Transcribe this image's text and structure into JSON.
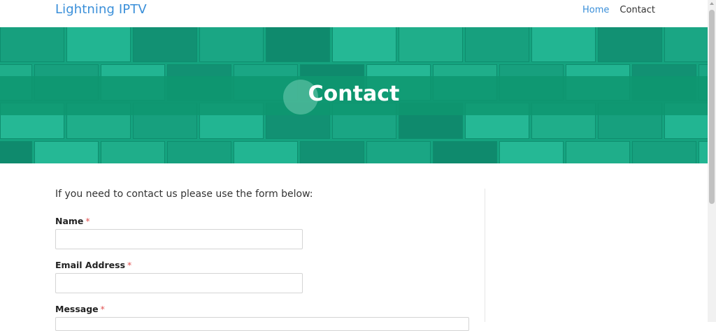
{
  "header": {
    "brand": "Lightning IPTV",
    "nav": [
      {
        "label": "Home",
        "active": true
      },
      {
        "label": "Contact",
        "active": false
      }
    ]
  },
  "hero": {
    "title": "Contact",
    "accent_color": "#15a37f"
  },
  "form": {
    "intro": "If you need to contact us please use the form below:",
    "required_mark": "*",
    "fields": [
      {
        "label": "Name",
        "value": "",
        "placeholder": ""
      },
      {
        "label": "Email Address",
        "value": "",
        "placeholder": ""
      },
      {
        "label": "Message",
        "value": "",
        "placeholder": ""
      }
    ]
  },
  "colors": {
    "link": "#3a8fd9",
    "required": "#e05252"
  }
}
